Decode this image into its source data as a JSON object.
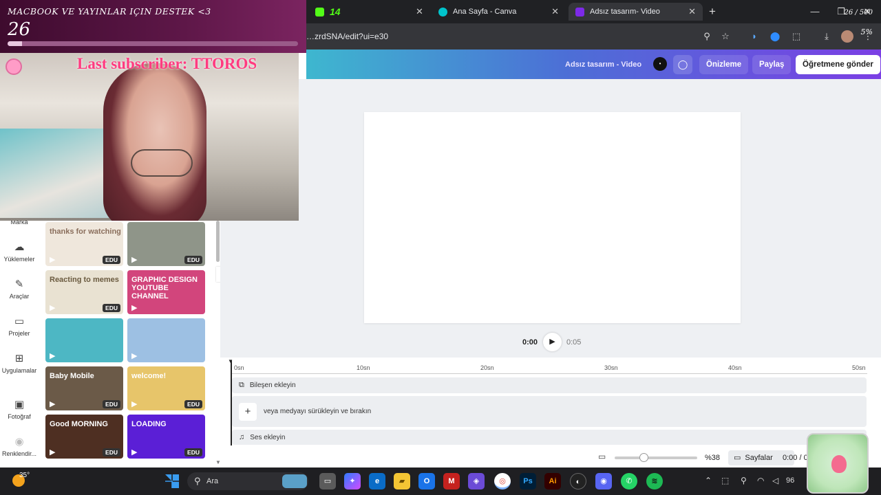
{
  "browser": {
    "tabs": [
      {
        "label": "14",
        "active": false
      },
      {
        "label": "Ana Sayfa - Canva",
        "active": false
      },
      {
        "label": "Adsız tasarım- Video",
        "active": true
      }
    ],
    "url": "…zrdSNA/edit?ui=e30"
  },
  "overlay": {
    "goal_title": "MACBOOK VE YAYINLAR IÇIN DESTEK <3",
    "goal_value": "26",
    "goal_count": "26 / 500",
    "goal_percent": "5%",
    "goal_progress": 0.05,
    "last_subscriber": "Last subscriber: TTOROS"
  },
  "canva": {
    "design_title": "Adsız tasarım - Video",
    "preview_label": "Önizleme",
    "share_label": "Paylaş",
    "send_label": "Öğretmene gönder",
    "nav": [
      "Marka",
      "Yüklemeler",
      "Araçlar",
      "Projeler",
      "Uygulamalar",
      "Fotoğraf",
      "Renklendir..."
    ],
    "thumbs": [
      {
        "text": "thanks for watching",
        "edu": "EDU",
        "color": "#efe7dc",
        "fg": "#8a6e5c"
      },
      {
        "text": "",
        "edu": "EDU",
        "color": "#8f9589",
        "fg": "#fff"
      },
      {
        "text": "Reacting to memes",
        "edu": "EDU",
        "color": "#e9e2d2",
        "fg": "#6a5a3f"
      },
      {
        "text": "GRAPHIC DESIGN YOUTUBE CHANNEL",
        "edu": "",
        "color": "#d2457c",
        "fg": "#fff"
      },
      {
        "text": "",
        "edu": "",
        "color": "#4db7c4",
        "fg": "#fff"
      },
      {
        "text": "",
        "edu": "",
        "color": "#9dc0e3",
        "fg": "#fff"
      },
      {
        "text": "Baby Mobile",
        "edu": "EDU",
        "color": "#6b5a48",
        "fg": "#fff"
      },
      {
        "text": "welcome!",
        "edu": "EDU",
        "color": "#e7c56a",
        "fg": "#fff"
      },
      {
        "text": "Good MORNING",
        "edu": "EDU",
        "color": "#4e2f22",
        "fg": "#fff"
      },
      {
        "text": "LOADING",
        "edu": "EDU",
        "color": "#5b1fd6",
        "fg": "#fff"
      }
    ],
    "time_current": "0:00",
    "time_total": "0:05",
    "ruler_ticks": [
      "0sn",
      "10sn",
      "20sn",
      "30sn",
      "40sn",
      "50sn"
    ],
    "track_components": "Bileşen ekleyin",
    "track_media": "veya medyayı sürükleyin ve bırakın",
    "track_audio": "Ses ekleyin",
    "zoom_value": "%38",
    "pages_label": "Sayfalar",
    "bottom_time": "0:00 / 0"
  },
  "taskbar": {
    "weather": "35°",
    "search_placeholder": "Ara",
    "apps": [
      {
        "label": "Ps",
        "color": "#001e36",
        "fg": "#31a8ff"
      },
      {
        "label": "Ai",
        "color": "#330000",
        "fg": "#ff9a00"
      }
    ],
    "battery_text": "96"
  }
}
